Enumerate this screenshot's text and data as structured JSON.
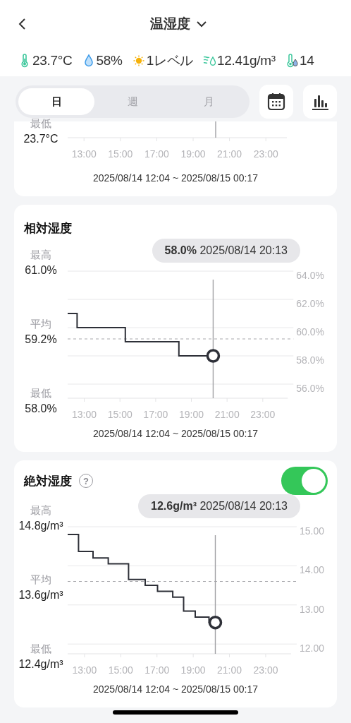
{
  "header": {
    "title": "温湿度"
  },
  "readings": [
    {
      "kind": "temperature",
      "value": "23.7°C"
    },
    {
      "kind": "humidity",
      "value": "58%"
    },
    {
      "kind": "light",
      "value": "1レベル"
    },
    {
      "kind": "absolute_humidity",
      "value": "12.41g/m³"
    },
    {
      "kind": "dew_point",
      "value": "14"
    }
  ],
  "tabs": [
    {
      "label": "日",
      "selected": true
    },
    {
      "label": "週",
      "selected": false
    },
    {
      "label": "月",
      "selected": false
    }
  ],
  "cards": [
    {
      "kind": "partial",
      "stats": [
        {
          "label": "最低",
          "value": "23.7°C"
        }
      ],
      "xticks": [
        "13:00",
        "15:00",
        "17:00",
        "19:00",
        "21:00",
        "23:00"
      ],
      "range": "2025/08/14 12:04 ~ 2025/08/15 00:17"
    },
    {
      "kind": "chart",
      "title": "相対湿度",
      "tooltip": "**58.0%** 2025/08/14 20:13",
      "stats": [
        {
          "label": "最高",
          "value": "61.0%"
        },
        {
          "label": "平均",
          "value": "59.2%"
        },
        {
          "label": "最低",
          "value": "58.0%"
        }
      ],
      "chart_data": {
        "type": "line",
        "grid": true,
        "x": [
          12.07,
          12.6,
          12.6,
          15.3,
          15.3,
          18.3,
          18.3,
          20.22
        ],
        "series": [
          {
            "color": "#2e3038",
            "values": [
              61,
              61,
              60,
              60,
              59,
              59,
              58,
              58
            ]
          }
        ],
        "xlim": [
          12.07,
          24.4
        ],
        "ylim": [
          55,
          64
        ],
        "xticks": [
          {
            "value": 13,
            "label": "13:00"
          },
          {
            "value": 15,
            "label": "15:00"
          },
          {
            "value": 17,
            "label": "17:00"
          },
          {
            "value": 19,
            "label": "19:00"
          },
          {
            "value": 21,
            "label": "21:00"
          },
          {
            "value": 23,
            "label": "23:00"
          }
        ],
        "yticks": [
          {
            "value": 64,
            "label": "64.0%"
          },
          {
            "value": 62,
            "label": "62.0%"
          },
          {
            "value": 60,
            "label": "60.0%"
          },
          {
            "value": 58,
            "label": "58.0%"
          },
          {
            "value": 56,
            "label": "56.0%"
          }
        ],
        "ref_lines": [
          {
            "axis": "y",
            "value": 59.2
          },
          {
            "axis": "x",
            "value": 20.22
          }
        ]
      },
      "range": "2025/08/14 12:04 ~ 2025/08/15 00:17"
    },
    {
      "kind": "chart",
      "title": "絶対湿度",
      "help": "?",
      "toggle": {
        "on": true
      },
      "tooltip": "**12.6g/m³** 2025/08/14 20:13",
      "stats": [
        {
          "label": "最高",
          "value": "14.8g/m³"
        },
        {
          "label": "平均",
          "value": "13.6g/m³"
        },
        {
          "label": "最低",
          "value": "12.4g/m³"
        }
      ],
      "chart_data": {
        "type": "line",
        "grid": true,
        "x": [
          12.07,
          12.67,
          12.67,
          13.47,
          13.47,
          14.31,
          14.31,
          15.43,
          15.43,
          16.35,
          16.35,
          17.03,
          17.03,
          17.87,
          17.87,
          18.47,
          18.47,
          19.11,
          19.11,
          19.87,
          19.87,
          20.22
        ],
        "series": [
          {
            "color": "#2e3038",
            "values": [
              14.8,
              14.8,
              14.37,
              14.37,
              14.2,
              14.2,
              14.05,
              14.05,
              13.65,
              13.65,
              13.5,
              13.5,
              13.35,
              13.35,
              13.2,
              13.2,
              12.84,
              12.84,
              12.69,
              12.69,
              12.55,
              12.55
            ]
          }
        ],
        "xlim": [
          12.07,
          24.4
        ],
        "ylim": [
          11.75,
          15
        ],
        "xticks": [
          {
            "value": 13,
            "label": "13:00"
          },
          {
            "value": 15,
            "label": "15:00"
          },
          {
            "value": 17,
            "label": "17:00"
          },
          {
            "value": 19,
            "label": "19:00"
          },
          {
            "value": 21,
            "label": "21:00"
          },
          {
            "value": 23,
            "label": "23:00"
          }
        ],
        "yticks": [
          {
            "value": 15,
            "label": "15.00"
          },
          {
            "value": 14,
            "label": "14.00"
          },
          {
            "value": 13,
            "label": "13.00"
          },
          {
            "value": 12,
            "label": "12.00"
          }
        ],
        "ref_lines": [
          {
            "axis": "y",
            "value": 13.6
          },
          {
            "axis": "x",
            "value": 20.22
          }
        ]
      },
      "range": "2025/08/14 12:04 ~ 2025/08/15 00:17"
    }
  ]
}
